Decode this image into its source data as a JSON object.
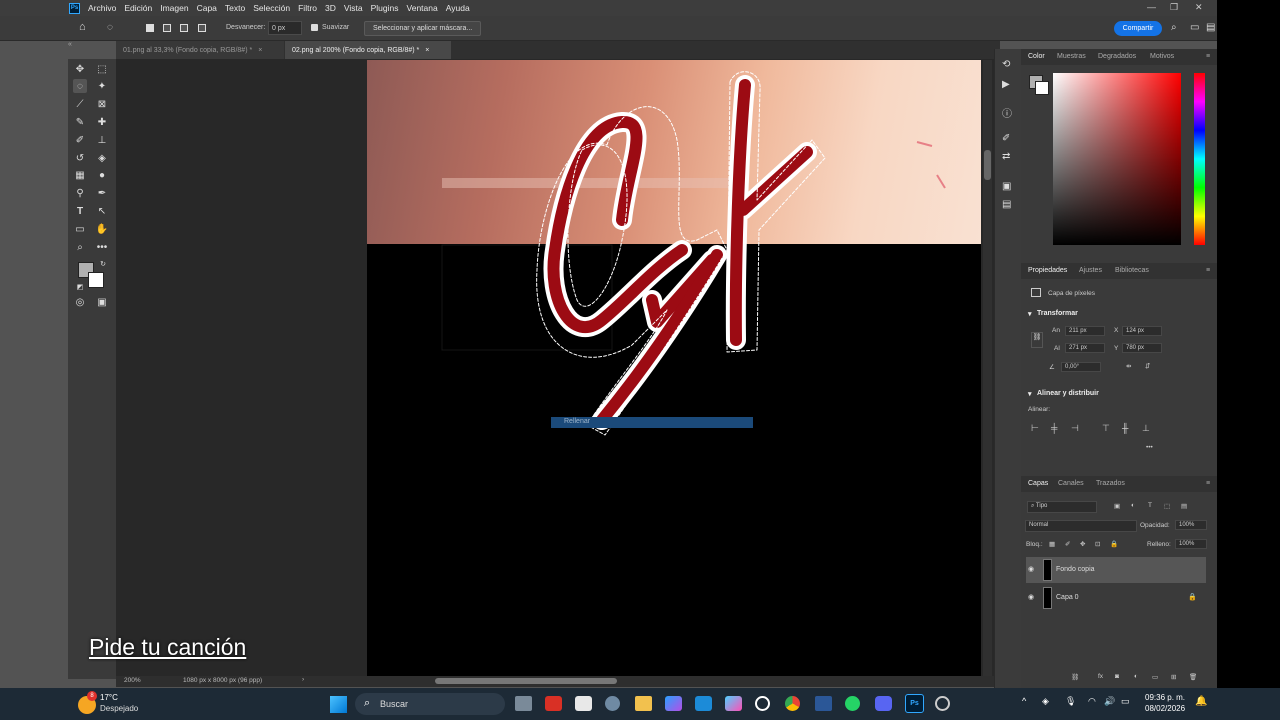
{
  "menu": {
    "items": [
      "Archivo",
      "Edición",
      "Imagen",
      "Capa",
      "Texto",
      "Selección",
      "Filtro",
      "3D",
      "Vista",
      "Plugins",
      "Ventana",
      "Ayuda"
    ]
  },
  "options": {
    "feather_label": "Desvanecer:",
    "feather_value": "0 px",
    "antialias_label": "Suavizar",
    "mask_button": "Seleccionar y aplicar máscara...",
    "share_button": "Compartir"
  },
  "tabs": [
    {
      "label": "01.png al 33,3% (Fondo copia, RGB/8#) *"
    },
    {
      "label": "02.png al 200% (Fondo copia, RGB/8#) *"
    }
  ],
  "canvas": {
    "fill_tooltip": "Rellenar"
  },
  "status": {
    "zoom": "200%",
    "doc_info": "1080 px x 8000 px (96 ppp)"
  },
  "color_panel": {
    "tabs": [
      "Color",
      "Muestras",
      "Degradados",
      "Motivos"
    ],
    "fg_color": "#b0b0b0",
    "bg_color": "#ffffff"
  },
  "properties": {
    "tabs": [
      "Propiedades",
      "Ajustes",
      "Bibliotecas"
    ],
    "type": "Capa de píxeles",
    "transform_title": "Transformar",
    "w_label": "An",
    "w_value": "211 px",
    "x_label": "X",
    "x_value": "124 px",
    "h_label": "Al",
    "h_value": "271 px",
    "y_label": "Y",
    "y_value": "780 px",
    "angle_value": "0,00°",
    "align_title": "Alinear y distribuir",
    "align_label": "Alinear:"
  },
  "layers_panel": {
    "tabs": [
      "Capas",
      "Canales",
      "Trazados"
    ],
    "filter": "Tipo",
    "blend_mode": "Normal",
    "opacity_label": "Opacidad:",
    "opacity_value": "100%",
    "lock_label": "Bloq.:",
    "fill_label": "Relleno:",
    "fill_value": "100%",
    "layers": [
      {
        "name": "Fondo copia"
      },
      {
        "name": "Capa 0"
      }
    ]
  },
  "overlay": {
    "text": "Pide tu canción"
  },
  "taskbar": {
    "weather_temp": "17°C",
    "weather_desc": "Despejado",
    "search": "Buscar",
    "time": "09:36 p. m.",
    "date": "08/02/2026",
    "notif_badge": "8"
  }
}
